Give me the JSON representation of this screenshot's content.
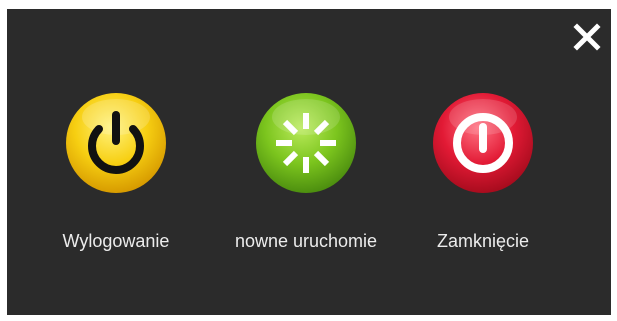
{
  "dialog": {
    "close_icon": "close-icon",
    "actions": [
      {
        "label": "Wylogowanie",
        "icon": "power-icon",
        "color": "#f2c400"
      },
      {
        "label": "nowne uruchomie",
        "icon": "spinner-icon",
        "color": "#6cb81c"
      },
      {
        "label": "Zamknięcie",
        "icon": "shutdown-icon",
        "color": "#d9122c"
      }
    ]
  }
}
